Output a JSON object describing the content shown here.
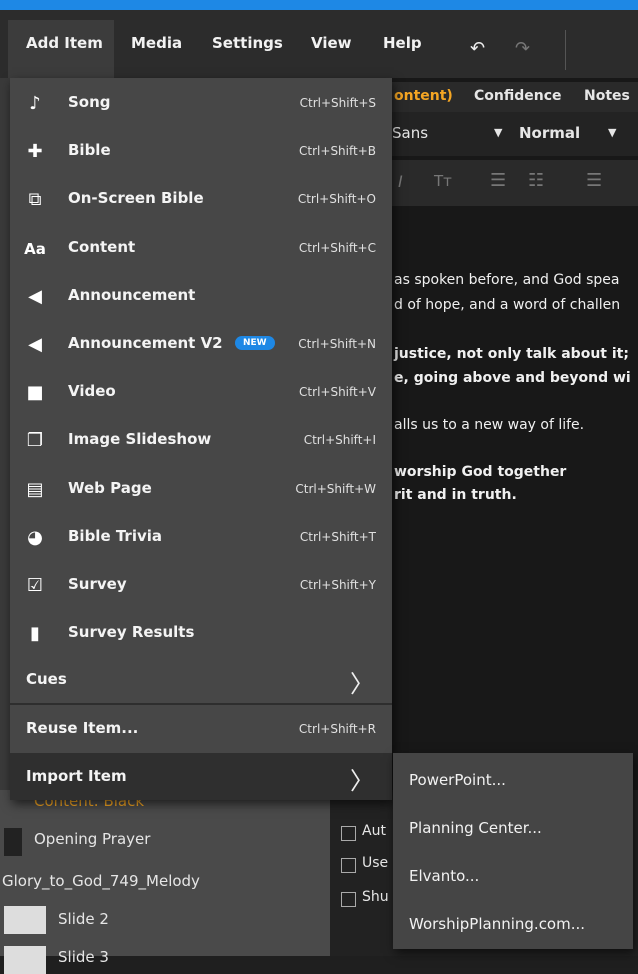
{
  "menubar": {
    "items": [
      "Add Item",
      "Media",
      "Settings",
      "View",
      "Help"
    ],
    "undo": "↶",
    "redo": "↷"
  },
  "background": {
    "tabs": [
      "ontent)",
      "Confidence",
      "Notes"
    ],
    "font_name": "Sans",
    "font_weight": "Normal",
    "lines": [
      "as spoken before, and God spea",
      "d of hope, and a word of challen",
      "justice, not only talk about it;",
      "e, going above and beyond wi",
      "alls us to a new way of life.",
      "worship God together",
      "rit and in truth."
    ],
    "bottom_left": {
      "content_black": "Content: Black",
      "opening_prayer": "Opening Prayer",
      "melody": "Glory_to_God_749_Melody",
      "slide2": "Slide 2",
      "slide3": "Slide 3"
    },
    "checkboxes": [
      "Aut",
      "Use",
      "Shu"
    ]
  },
  "menu": {
    "items": [
      {
        "icon": "music-note-icon",
        "glyph": "♪",
        "label": "Song",
        "shortcut": "Ctrl+Shift+S"
      },
      {
        "icon": "bible-icon",
        "glyph": "✚",
        "label": "Bible",
        "shortcut": "Ctrl+Shift+B"
      },
      {
        "icon": "on-screen-bible-icon",
        "glyph": "⧉",
        "label": "On-Screen Bible",
        "shortcut": "Ctrl+Shift+O"
      },
      {
        "icon": "content-icon",
        "glyph": "Aa",
        "label": "Content",
        "shortcut": "Ctrl+Shift+C"
      },
      {
        "icon": "megaphone-icon",
        "glyph": "◀",
        "label": "Announcement",
        "shortcut": ""
      },
      {
        "icon": "megaphone-v2-icon",
        "glyph": "◀",
        "label": "Announcement V2",
        "shortcut": "Ctrl+Shift+N",
        "badge": "NEW"
      },
      {
        "icon": "video-camera-icon",
        "glyph": "■",
        "label": "Video",
        "shortcut": "Ctrl+Shift+V"
      },
      {
        "icon": "slideshow-icon",
        "glyph": "❐",
        "label": "Image Slideshow",
        "shortcut": "Ctrl+Shift+I"
      },
      {
        "icon": "web-page-icon",
        "glyph": "▤",
        "label": "Web Page",
        "shortcut": "Ctrl+Shift+W"
      },
      {
        "icon": "pie-chart-icon",
        "glyph": "◕",
        "label": "Bible Trivia",
        "shortcut": "Ctrl+Shift+T"
      },
      {
        "icon": "survey-check-icon",
        "glyph": "☑",
        "label": "Survey",
        "shortcut": "Ctrl+Shift+Y"
      },
      {
        "icon": "bar-chart-icon",
        "glyph": "▮",
        "label": "Survey Results",
        "shortcut": ""
      }
    ],
    "cues_label": "Cues",
    "reuse_label": "Reuse Item...",
    "reuse_shortcut": "Ctrl+Shift+R",
    "import_label": "Import Item",
    "chevron": "〉"
  },
  "submenu": {
    "items": [
      "PowerPoint...",
      "Planning Center...",
      "Elvanto...",
      "WorshipPlanning.com..."
    ]
  }
}
